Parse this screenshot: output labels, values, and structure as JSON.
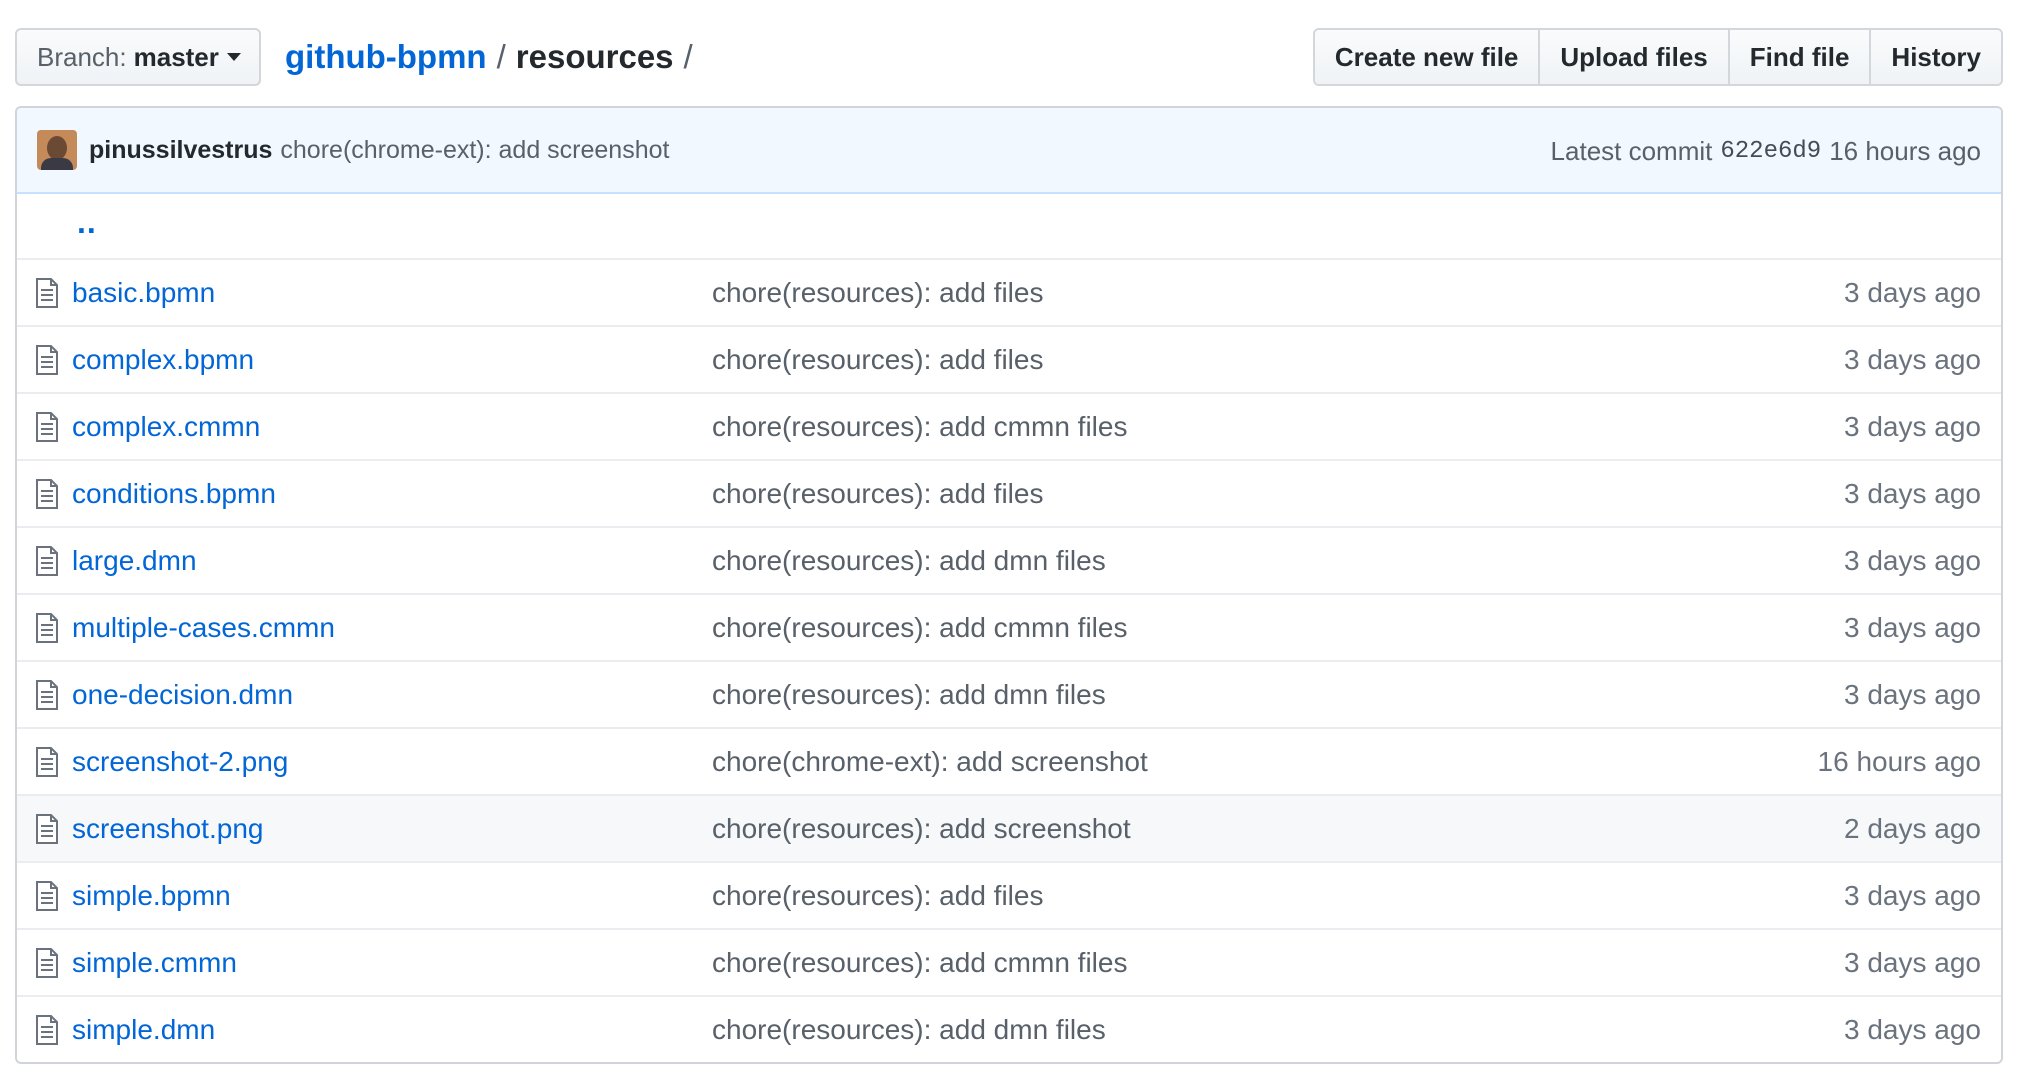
{
  "toolbar": {
    "branch_prefix": "Branch:",
    "branch_name": "master",
    "repo_name": "github-bpmn",
    "path_sep_1": "/",
    "current_dir": "resources",
    "path_sep_2": "/",
    "buttons": {
      "create_new_file": "Create new file",
      "upload_files": "Upload files",
      "find_file": "Find file",
      "history": "History"
    }
  },
  "latest_commit": {
    "author": "pinussilvestrus",
    "message": "chore(chrome-ext): add screenshot",
    "prefix": "Latest commit",
    "sha": "622e6d9",
    "age": "16 hours ago"
  },
  "parent_link": "..",
  "files": [
    {
      "name": "basic.bpmn",
      "message": "chore(resources): add files",
      "age": "3 days ago"
    },
    {
      "name": "complex.bpmn",
      "message": "chore(resources): add files",
      "age": "3 days ago"
    },
    {
      "name": "complex.cmmn",
      "message": "chore(resources): add cmmn files",
      "age": "3 days ago"
    },
    {
      "name": "conditions.bpmn",
      "message": "chore(resources): add files",
      "age": "3 days ago"
    },
    {
      "name": "large.dmn",
      "message": "chore(resources): add dmn files",
      "age": "3 days ago"
    },
    {
      "name": "multiple-cases.cmmn",
      "message": "chore(resources): add cmmn files",
      "age": "3 days ago"
    },
    {
      "name": "one-decision.dmn",
      "message": "chore(resources): add dmn files",
      "age": "3 days ago"
    },
    {
      "name": "screenshot-2.png",
      "message": "chore(chrome-ext): add screenshot",
      "age": "16 hours ago"
    },
    {
      "name": "screenshot.png",
      "message": "chore(resources): add screenshot",
      "age": "2 days ago"
    },
    {
      "name": "simple.bpmn",
      "message": "chore(resources): add files",
      "age": "3 days ago"
    },
    {
      "name": "simple.cmmn",
      "message": "chore(resources): add cmmn files",
      "age": "3 days ago"
    },
    {
      "name": "simple.dmn",
      "message": "chore(resources): add dmn files",
      "age": "3 days ago"
    }
  ],
  "highlighted_row": 8,
  "colors": {
    "link": "#0366d6",
    "commit_bar_bg": "#f1f8ff",
    "muted_text": "#586069",
    "row_border": "#eaecef"
  },
  "icons": {
    "file": "file-text-icon",
    "caret": "triangle-down-icon"
  }
}
